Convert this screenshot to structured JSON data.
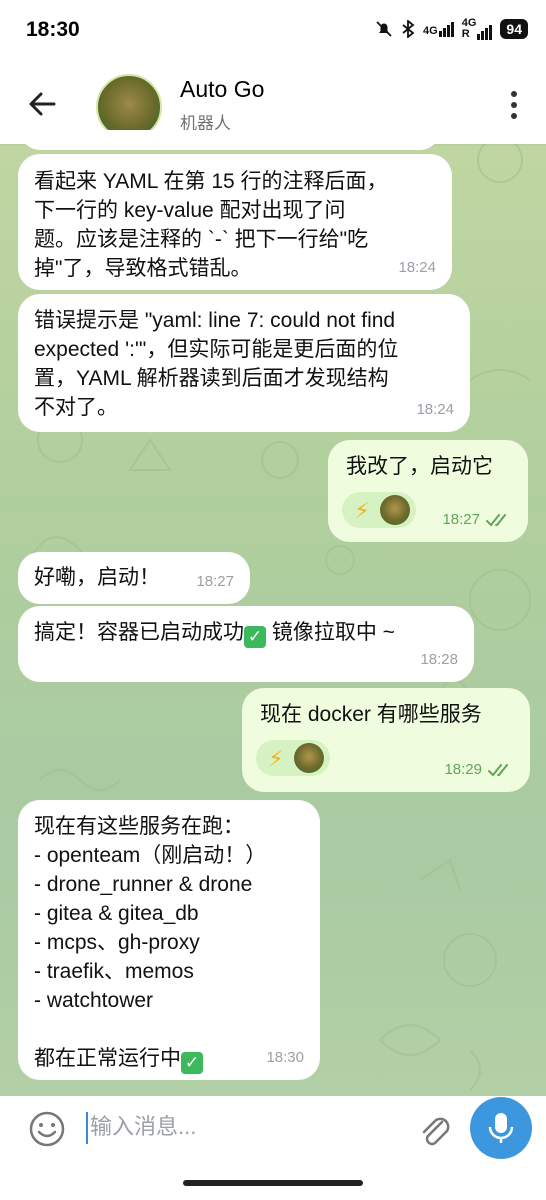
{
  "status_bar": {
    "time": "18:30",
    "battery": "94",
    "signal_1": "4G",
    "signal_2": "4G",
    "signal_2_sub": "R"
  },
  "header": {
    "title": "Auto Go",
    "subtitle": "机器人"
  },
  "messages": [
    {
      "dir": "in",
      "text": "看起来 YAML 在第 15 行的注释后面，\n下一行的 key-value 配对出现了问\n题。应该是注释的 `-` 把下一行给\"吃\n掉\"了，导致格式错乱。",
      "time": "18:24"
    },
    {
      "dir": "in",
      "text": "错误提示是 \"yaml: line 7: could not find\nexpected ':'\"，但实际可能是更后面的位\n置，YAML 解析器读到后面才发现结构\n不对了。",
      "time": "18:24"
    },
    {
      "dir": "out",
      "text": "我改了，启动它",
      "time": "18:27",
      "reaction": "⚡"
    },
    {
      "dir": "in",
      "text": "好嘞，启动！",
      "time": "18:27"
    },
    {
      "dir": "in",
      "text_before": "搞定！容器已启动成功",
      "check": "✓",
      "text_after": " 镜像拉取中 ~",
      "time": "18:28"
    },
    {
      "dir": "out",
      "text": "现在 docker 有哪些服务",
      "time": "18:29",
      "reaction": "⚡"
    },
    {
      "dir": "in",
      "text": "现在有这些服务在跑：\n- openteam（刚启动！）\n- drone_runner & drone\n- gitea & gitea_db\n- mcps、gh-proxy\n- traefik、memos\n- watchtower\n\n都在正常运行中",
      "check": "✓",
      "time": "18:30"
    }
  ],
  "input": {
    "placeholder": "输入消息..."
  },
  "colors": {
    "accent": "#3d97de",
    "out_bubble": "#effdde",
    "in_bubble": "#ffffff",
    "read_ticks": "#5fa55a",
    "check_green": "#3cb95c"
  },
  "icons": [
    "back-arrow-icon",
    "more-vertical-icon",
    "emoji-icon",
    "paperclip-icon",
    "microphone-icon",
    "double-check-icon",
    "lightning-icon"
  ]
}
